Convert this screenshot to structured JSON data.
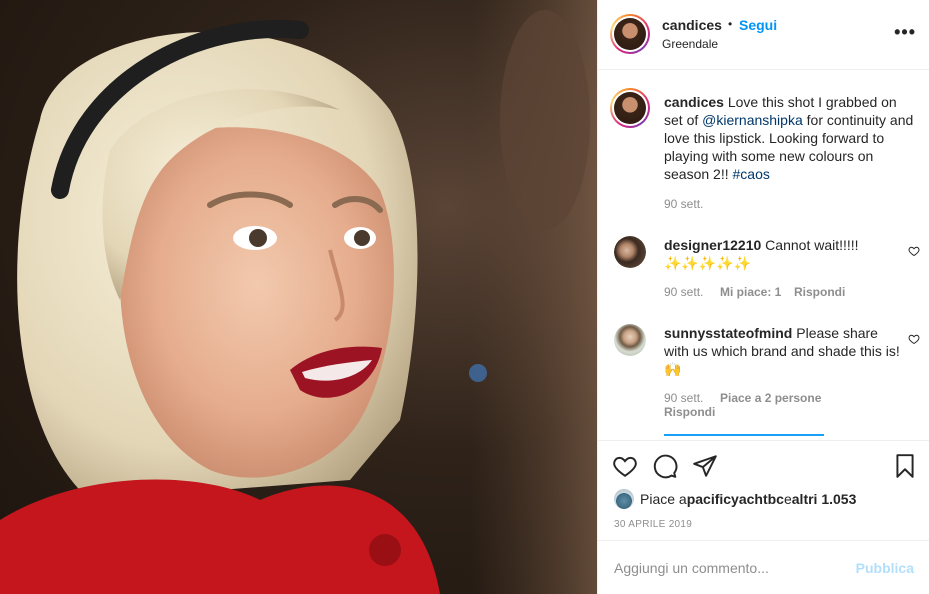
{
  "post": {
    "author": "candices",
    "follow_label": "Segui",
    "separator": "•",
    "location": "Greendale",
    "more_label": "•••"
  },
  "caption": {
    "username": "candices",
    "text_1": " Love this shot I grabbed on set of ",
    "mention": "@kiernanshipka",
    "text_2": " for continuity and love this lipstick. Looking forward to playing with some new colours on season 2!! ",
    "hashtag": "#caos",
    "time": "90 sett."
  },
  "comments": [
    {
      "username": "designer12210",
      "text": " Cannot wait!!!!!",
      "emoji": "✨✨✨✨✨",
      "time": "90 sett.",
      "likes": "Mi piace: 1",
      "reply": "Rispondi"
    },
    {
      "username": "sunnysstateofmind",
      "text": " Please share with us which brand and shade this is! ",
      "emoji": "🙌",
      "time": "90 sett.",
      "likes": "Piace a 2 persone",
      "reply": "Rispondi"
    }
  ],
  "likes": {
    "prefix": "Piace a ",
    "user": "pacificyachtbc",
    "middle": " e ",
    "others": "altri 1.053"
  },
  "date": "30 APRILE 2019",
  "add_comment": {
    "placeholder": "Aggiungi un commento...",
    "publish_label": "Pubblica"
  },
  "colors": {
    "link": "#00376b",
    "accent": "#0095f6",
    "muted": "#8e8e8e",
    "publish_disabled": "#b2dffc"
  },
  "icons": [
    "heart-icon",
    "comment-icon",
    "share-icon",
    "bookmark-icon",
    "more-options-icon"
  ]
}
